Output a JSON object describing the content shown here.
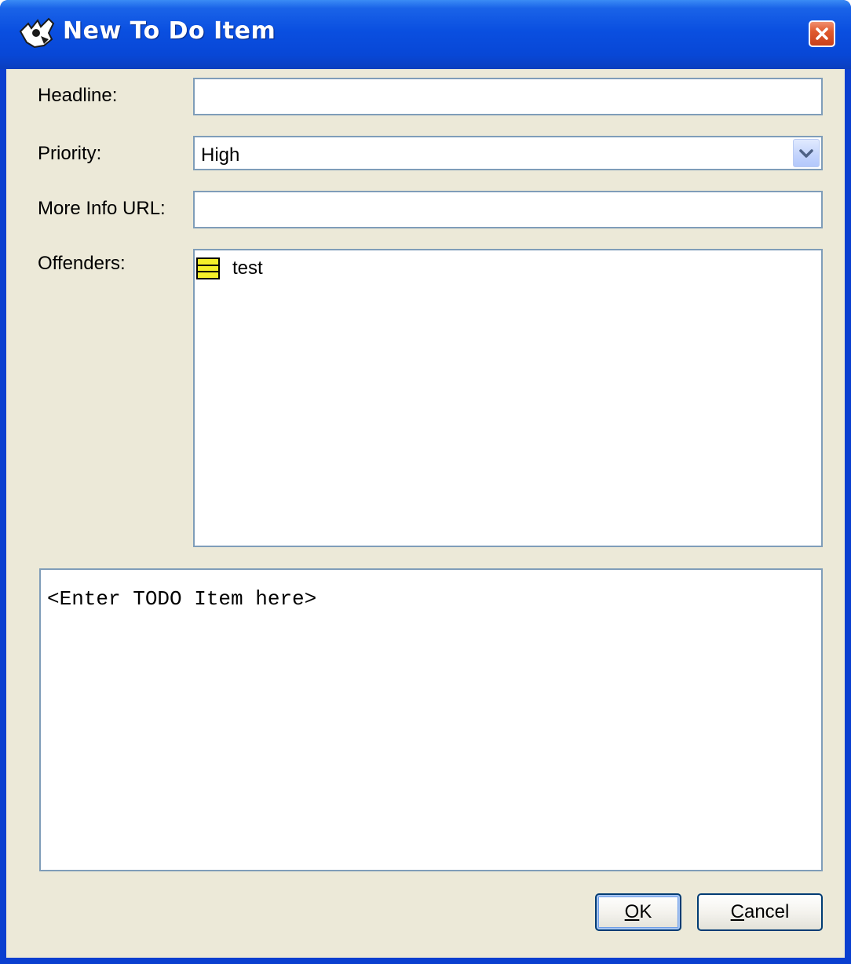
{
  "window": {
    "title": "New To Do Item"
  },
  "form": {
    "headline_label": "Headline:",
    "headline_value": "",
    "priority_label": "Priority:",
    "priority_value": "High",
    "more_info_label": "More Info URL:",
    "more_info_value": "",
    "offenders_label": "Offenders:",
    "offenders": [
      {
        "label": "test",
        "icon": "class-icon"
      }
    ],
    "description_text": "<Enter TODO Item here>"
  },
  "buttons": {
    "ok_label": "OK",
    "cancel_label": "Cancel"
  },
  "colors": {
    "titlebar": "#0a4fe0",
    "client_background": "#ece9d8",
    "field_border": "#7f9db9",
    "close_button": "#e05a2e",
    "offender_icon": "#f5ef2a"
  }
}
